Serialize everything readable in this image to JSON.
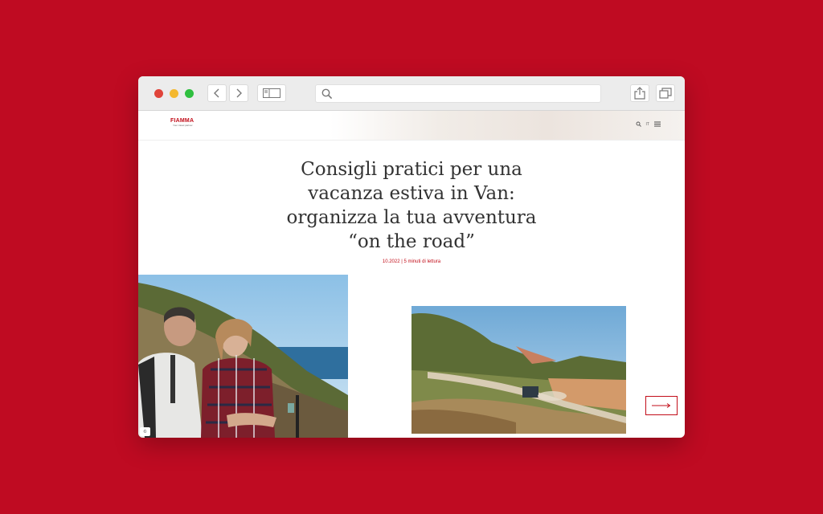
{
  "browser": {
    "icons": [
      "chevron-left-icon",
      "chevron-right-icon",
      "sidebar-icon",
      "search-icon",
      "share-icon",
      "tabs-icon"
    ]
  },
  "site": {
    "logo_text": "FIAMMA",
    "logo_tagline": "Your travel partner",
    "lang_label": "IT",
    "accent_color": "#c20e1a"
  },
  "article": {
    "title_lines": [
      "Consigli pratici per una",
      "vacanza estiva in Van:",
      "organizza la tua avventura",
      "“on the road”"
    ],
    "meta": "10.2022 | 5 minuti di lettura"
  },
  "gallery": {
    "copy_badge": "©"
  },
  "page_background": "#bf0b22"
}
